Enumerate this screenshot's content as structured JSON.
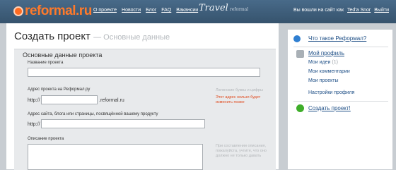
{
  "header": {
    "logo": "reformal.ru",
    "nav": [
      "О проекте",
      "Новости",
      "Блог",
      "FAQ",
      "Вакансии"
    ],
    "travel_brand": "Travel",
    "travel_sub": "reformal",
    "user_text": "Вы вошли на сайт как",
    "user_name": "Ted'a Snor",
    "logout": "Выйти"
  },
  "main": {
    "title": "Создать проект",
    "subtitle": "— Основные данные",
    "section_title": "Основные данные проекта",
    "fields": {
      "name_label": "Название проекта",
      "name_value": "",
      "address_label": "Адрес проекта на Реформал.ру",
      "address_prefix": "http://",
      "address_suffix": ".reformal.ru",
      "address_value": "",
      "address_hint": "Латинские буквы и цифры",
      "address_error": "Этот адрес нельзя будет изменить позже",
      "site_label": "Адрес сайта, блога или страницы, посвящённой вашему продукту",
      "site_prefix": "http://",
      "site_value": "",
      "desc_label": "Описание проекта",
      "desc_value": "",
      "desc_hint": "При составлении описания, пожалуйста, учтите, что оно должно не только давать"
    }
  },
  "sidebar": {
    "what_is": "Что такое Реформал?",
    "profile": "Мой профиль",
    "my_ideas": "Мои идеи",
    "ideas_count": "(1)",
    "my_comments": "Мои комментарии",
    "my_projects": "Мои проекты",
    "settings": "Настройки профиля",
    "create": "Создать проект!"
  },
  "colors": {
    "header_bg": "#3f5f7c",
    "logo_orange": "#ff6b21",
    "link_blue": "#1e4f86",
    "error_red": "#e04b1f"
  }
}
